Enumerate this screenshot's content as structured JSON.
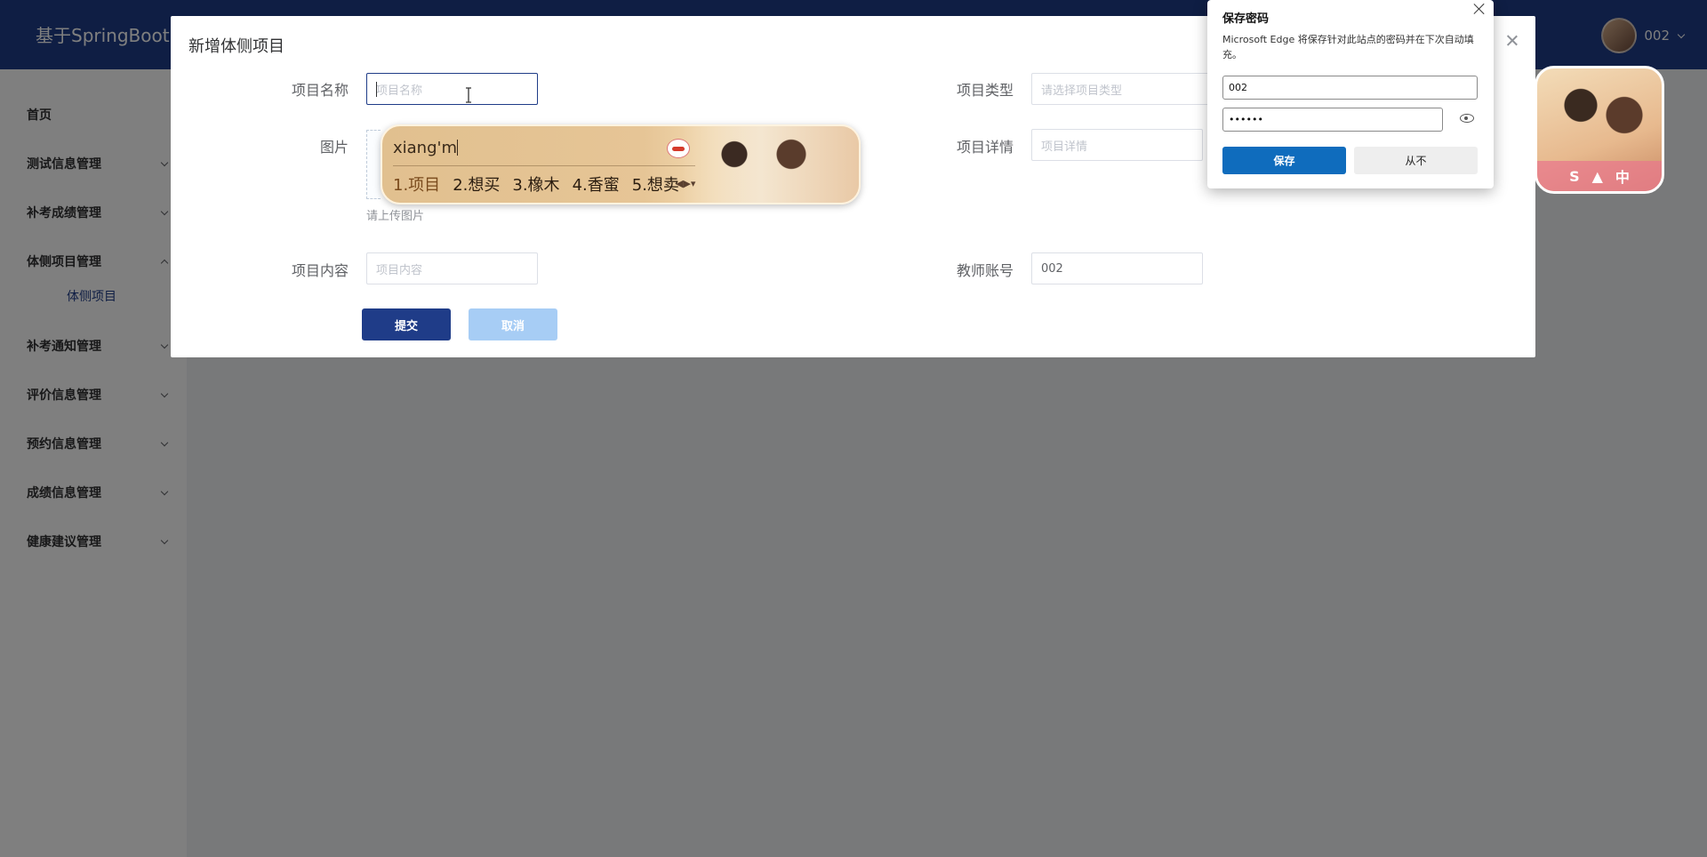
{
  "header": {
    "app_title": "基于SpringBoot",
    "username": "002"
  },
  "sidebar": {
    "items": [
      {
        "label": "首页"
      },
      {
        "label": "测试信息管理"
      },
      {
        "label": "补考成绩管理"
      },
      {
        "label": "体侧项目管理"
      },
      {
        "label": "补考通知管理"
      },
      {
        "label": "评价信息管理"
      },
      {
        "label": "预约信息管理"
      },
      {
        "label": "成绩信息管理"
      },
      {
        "label": "健康建议管理"
      }
    ],
    "active_sub": "体侧项目"
  },
  "dialog": {
    "title": "新增体侧项目",
    "fields": {
      "name": {
        "label": "项目名称",
        "placeholder": "项目名称"
      },
      "type": {
        "label": "项目类型",
        "placeholder": "请选择项目类型"
      },
      "image": {
        "label": "图片",
        "hint": "请上传图片"
      },
      "detail": {
        "label": "项目详情",
        "placeholder": "项目详情"
      },
      "content": {
        "label": "项目内容",
        "placeholder": "项目内容"
      },
      "teacher": {
        "label": "教师账号",
        "value": "002"
      }
    },
    "submit_label": "提交",
    "cancel_label": "取消"
  },
  "ime": {
    "pinyin": "xiang'm",
    "candidates": [
      "1.项目",
      "2.想买",
      "3.橡木",
      "4.香蜜",
      "5.想卖"
    ]
  },
  "password_popup": {
    "title": "保存密码",
    "description": "Microsoft Edge 将保存针对此站点的密码并在下次自动填充。",
    "username": "002",
    "password_mask": "••••••",
    "save_label": "保存",
    "never_label": "从不"
  },
  "floating_widget": {
    "glyphs": [
      "S",
      "中"
    ]
  },
  "colors": {
    "header": "#1f3c88",
    "primary": "#1f3c88",
    "cancel": "#a7cdf5",
    "edge_blue": "#0f6cbd"
  }
}
